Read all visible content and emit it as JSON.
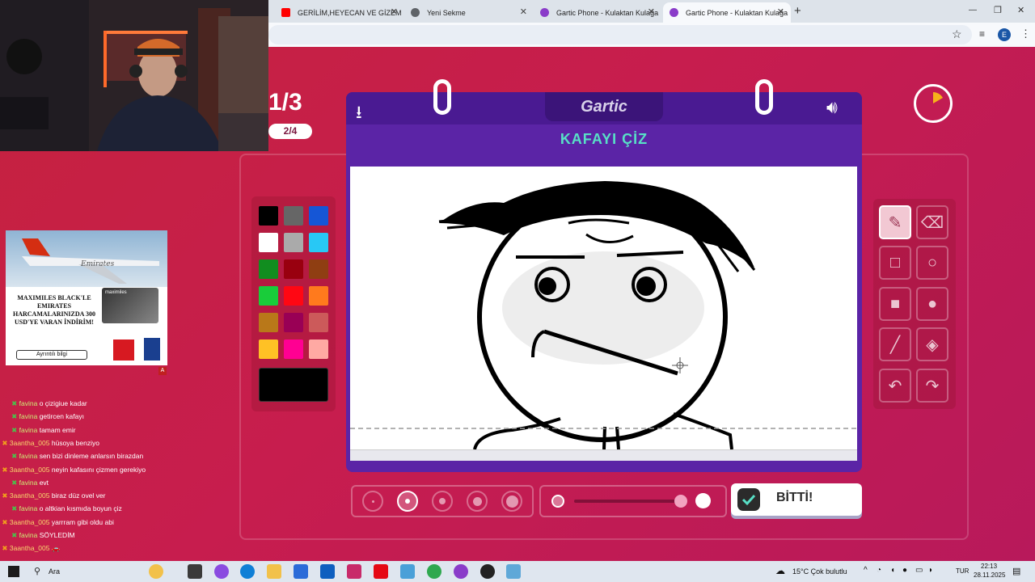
{
  "browser": {
    "tabs": [
      {
        "title": "GERİLİM,HEYECAN VE GİZEM",
        "close": "✕"
      },
      {
        "title": "Yeni Sekme",
        "close": "✕"
      },
      {
        "title": "Gartic Phone - Kulaktan Kulağa",
        "close": "✕"
      },
      {
        "title": "Gartic Phone - Kulaktan Kulağa",
        "close": "✕"
      }
    ],
    "new_tab": "+",
    "window_controls": [
      "—",
      "❐",
      "✕"
    ],
    "profile_initial": "E"
  },
  "game": {
    "round": "1/3",
    "subround": "2/4",
    "logo": "Gartic",
    "title": "KAFAYI ÇİZ",
    "done_label": "BİTTİ!",
    "current_color": "#000000",
    "palette": [
      [
        "#000000",
        "#666666",
        "#1556d6"
      ],
      [
        "#ffffff",
        "#aaaaaa",
        "#28c8f5"
      ],
      [
        "#118d1f",
        "#99000f",
        "#8f3e12"
      ],
      [
        "#19cc3a",
        "#ff0713",
        "#ff7a1d"
      ],
      [
        "#b97819",
        "#990055",
        "#cc5a5a"
      ],
      [
        "#ffc125",
        "#ff0092",
        "#ffa9a3"
      ]
    ],
    "tools": [
      [
        "pencil-icon",
        "eraser-icon"
      ],
      [
        "rectangle-outline-icon",
        "ellipse-outline-icon"
      ],
      [
        "rectangle-fill-icon",
        "ellipse-fill-icon"
      ],
      [
        "line-icon",
        "bucket-fill-icon"
      ],
      [
        "undo-icon",
        "redo-icon"
      ]
    ],
    "selected_tool": "pencil-icon",
    "brush_size_selected": 2,
    "opacity_level": 1.0
  },
  "ad": {
    "brand": "Emirates",
    "headline": "MAXIMILES BLACK'LE EMIRATES HARCAMALARINIZDA 300 USD'YE VARAN İNDİRİM!",
    "button": "Ayrıntılı bilgi",
    "card_label": "maximiles",
    "corner": "A"
  },
  "chat": [
    {
      "user": "favina",
      "msg": "o çizigiue kadar"
    },
    {
      "user": "favina",
      "msg": "getircen kafayı"
    },
    {
      "user": "favina",
      "msg": "tamam emir"
    },
    {
      "user": "3aantha_005",
      "msg": "hüsoya benziyo"
    },
    {
      "user": "favina",
      "msg": "sen bizi dinleme anlarsın birazdan"
    },
    {
      "user": "3aantha_005",
      "msg": "neyin kafasını çizmen gerekiyo"
    },
    {
      "user": "favina",
      "msg": "evt"
    },
    {
      "user": "3aantha_005",
      "msg": "biraz düz ovel ver"
    },
    {
      "user": "favina",
      "msg": "o altkian kısmıda boyun çiz"
    },
    {
      "user": "3aantha_005",
      "msg": "yarrram gibi oldu abi"
    },
    {
      "user": "favina",
      "msg": "SÖYLEDİM"
    },
    {
      "user": "3aantha_005",
      "msg": "🚗"
    }
  ],
  "taskbar": {
    "search": "Ara",
    "weather": "15°C  Çok bulutlu",
    "lang": "TUR",
    "time": "22:13",
    "date": "28.11.2025"
  }
}
